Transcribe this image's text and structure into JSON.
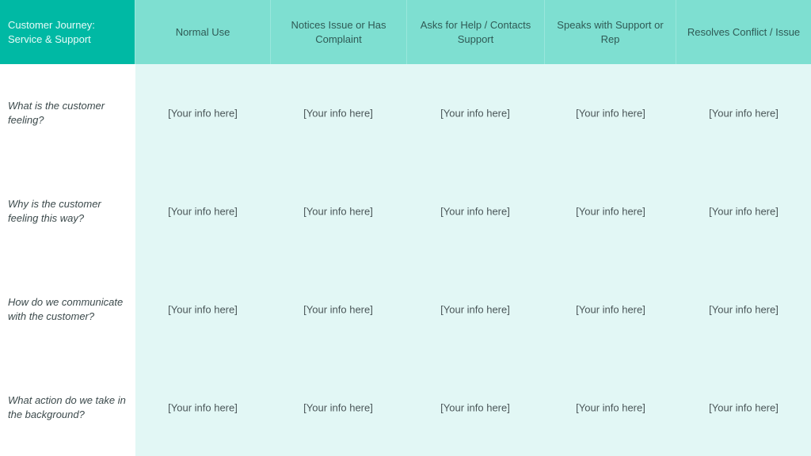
{
  "title": "Customer Journey: Service & Support",
  "stages": [
    {
      "label": "Normal Use"
    },
    {
      "label": "Notices Issue or Has Complaint"
    },
    {
      "label": "Asks for Help / Contacts Support"
    },
    {
      "label": "Speaks with Support or Rep"
    },
    {
      "label": "Resolves Conflict / Issue"
    }
  ],
  "rows": [
    {
      "question": "What is the customer feeling?",
      "cells": [
        "[Your info here]",
        "[Your info here]",
        "[Your info here]",
        "[Your info here]",
        "[Your info here]"
      ]
    },
    {
      "question": "Why is the customer feeling this way?",
      "cells": [
        "[Your info here]",
        "[Your info here]",
        "[Your info here]",
        "[Your info here]",
        "[Your info here]"
      ]
    },
    {
      "question": "How do we communicate with the customer?",
      "cells": [
        "[Your info here]",
        "[Your info here]",
        "[Your info here]",
        "[Your info here]",
        "[Your info here]"
      ]
    },
    {
      "question": "What action do we take in the background?",
      "cells": [
        "[Your info here]",
        "[Your info here]",
        "[Your info here]",
        "[Your info here]",
        "[Your info here]"
      ]
    }
  ],
  "colors": {
    "title_bg": "#00b9a4",
    "header_bg": "#7edfd1",
    "body_bg": "#e2f7f5"
  }
}
